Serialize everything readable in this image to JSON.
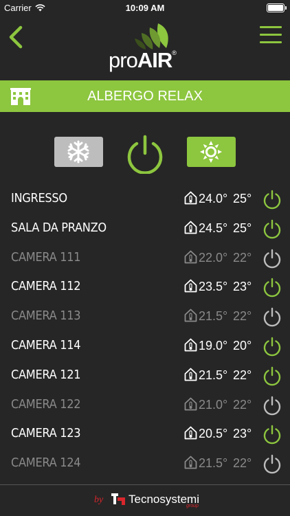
{
  "status": {
    "carrier": "Carrier",
    "time": "10:09 AM"
  },
  "header": {
    "logo_pre": "pro",
    "logo_bold": "AIR",
    "logo_mark": "®"
  },
  "banner": {
    "title": "ALBERGO RELAX"
  },
  "colors": {
    "accent": "#8dc63f",
    "background": "#262626",
    "inactive": "#8a8a8a",
    "brand_red": "#d9262c"
  },
  "rooms": [
    {
      "name": "INGRESSO",
      "current": "24.0°",
      "setpoint": "25°",
      "on": true
    },
    {
      "name": "SALA DA PRANZO",
      "current": "24.5°",
      "setpoint": "25°",
      "on": true
    },
    {
      "name": "CAMERA 111",
      "current": "22.0°",
      "setpoint": "22°",
      "on": false
    },
    {
      "name": "CAMERA 112",
      "current": "23.5°",
      "setpoint": "23°",
      "on": true
    },
    {
      "name": "CAMERA 113",
      "current": "21.5°",
      "setpoint": "22°",
      "on": false
    },
    {
      "name": "CAMERA 114",
      "current": "19.0°",
      "setpoint": "20°",
      "on": true
    },
    {
      "name": "CAMERA 121",
      "current": "21.5°",
      "setpoint": "22°",
      "on": true
    },
    {
      "name": "CAMERA 122",
      "current": "21.0°",
      "setpoint": "22°",
      "on": false
    },
    {
      "name": "CAMERA 123",
      "current": "20.5°",
      "setpoint": "23°",
      "on": true
    },
    {
      "name": "CAMERA 124",
      "current": "21.5°",
      "setpoint": "22°",
      "on": false
    }
  ],
  "footer": {
    "by": "by",
    "brand": "Tecnosystemi",
    "sub": "group"
  }
}
